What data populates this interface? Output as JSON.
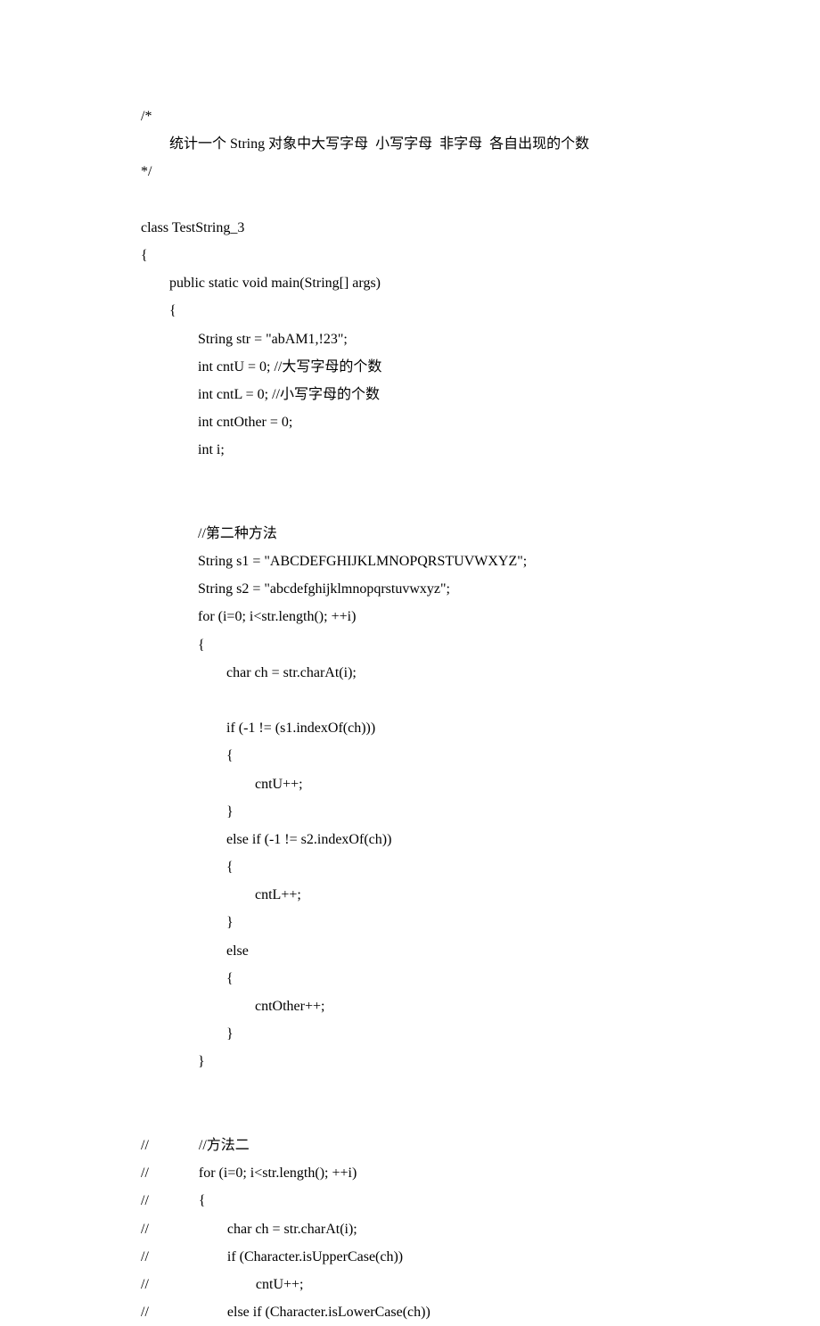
{
  "lines": [
    "/*",
    "        统计一个 String 对象中大写字母  小写字母  非字母  各自出现的个数",
    "*/",
    "",
    "class TestString_3",
    "{",
    "        public static void main(String[] args)",
    "        {",
    "                String str = \"abAM1,!23\";",
    "                int cntU = 0; //大写字母的个数",
    "                int cntL = 0; //小写字母的个数",
    "                int cntOther = 0;",
    "                int i;",
    "",
    "",
    "                //第二种方法",
    "                String s1 = \"ABCDEFGHIJKLMNOPQRSTUVWXYZ\";",
    "                String s2 = \"abcdefghijklmnopqrstuvwxyz\";",
    "                for (i=0; i<str.length(); ++i)",
    "                {",
    "                        char ch = str.charAt(i);",
    "",
    "                        if (-1 != (s1.indexOf(ch)))",
    "                        {",
    "                                cntU++;",
    "                        }",
    "                        else if (-1 != s2.indexOf(ch))",
    "                        {",
    "                                cntL++;",
    "                        }",
    "                        else",
    "                        {",
    "                                cntOther++;",
    "                        }",
    "                }",
    "",
    "",
    "//              //方法二",
    "//              for (i=0; i<str.length(); ++i)",
    "//              {",
    "//                      char ch = str.charAt(i);",
    "//                      if (Character.isUpperCase(ch))",
    "//                              cntU++;",
    "//                      else if (Character.isLowerCase(ch))"
  ]
}
